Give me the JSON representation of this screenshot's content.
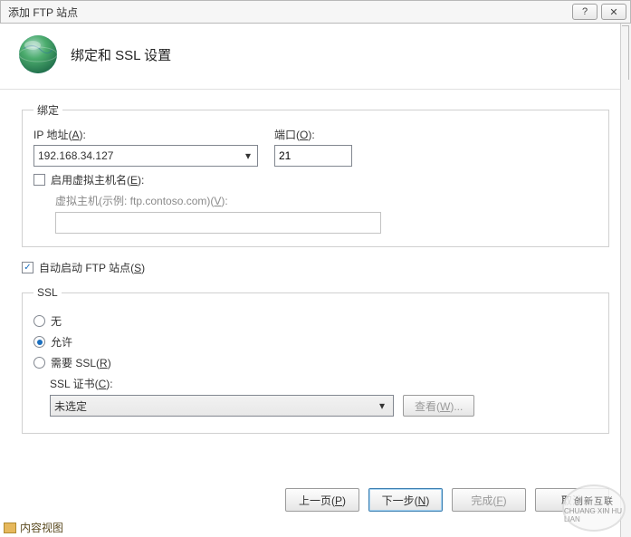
{
  "window": {
    "title": "添加 FTP 站点",
    "help_symbol": "?",
    "close_symbol": "✕"
  },
  "header": {
    "title": "绑定和 SSL 设置"
  },
  "binding": {
    "legend": "绑定",
    "ip_label": "IP 地址(",
    "ip_key": "A",
    "ip_label_end": "):",
    "ip_value": "192.168.34.127",
    "port_label": "端口(",
    "port_key": "O",
    "port_label_end": "):",
    "port_value": "21",
    "virtual_label": "启用虚拟主机名(",
    "virtual_key": "E",
    "virtual_label_end": "):",
    "virtual_checked": false,
    "virtual_host_label": "虚拟主机(示例: ftp.contoso.com)(",
    "virtual_host_key": "V",
    "virtual_host_label_end": "):",
    "virtual_host_value": ""
  },
  "auto_start": {
    "label": "自动启动 FTP 站点(",
    "key": "S",
    "label_end": ")",
    "checked": true
  },
  "ssl": {
    "legend": "SSL",
    "opt_none": "无",
    "opt_allow": "允许",
    "opt_require": "需要 SSL(",
    "opt_require_key": "R",
    "opt_require_end": ")",
    "selected": "allow",
    "cert_label": "SSL 证书(",
    "cert_key": "C",
    "cert_label_end": "):",
    "cert_value": "未选定",
    "view_label": "查看(",
    "view_key": "W",
    "view_end": ")..."
  },
  "footer": {
    "prev": "上一页(",
    "prev_key": "P",
    "prev_end": ")",
    "next": "下一步(",
    "next_key": "N",
    "next_end": ")",
    "finish": "完成(",
    "finish_key": "F",
    "finish_end": ")",
    "cancel": "取消"
  },
  "bottom_tab": {
    "label": "内容视图"
  },
  "watermark": {
    "cn": "创新互联",
    "en": "CHUANG XIN HU LIAN"
  }
}
